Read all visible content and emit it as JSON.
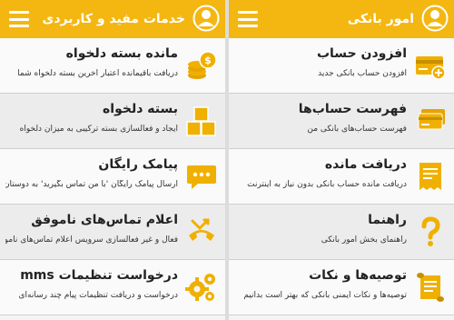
{
  "colors": {
    "accent": "#f4b611",
    "icon": "#f0b000",
    "text": "#222222"
  },
  "right_panel": {
    "title": "امور بانکی",
    "items": [
      {
        "title": "افزودن حساب",
        "subtitle": "افزودن حساب بانکی جدید",
        "icon": "add-card-icon"
      },
      {
        "title": "فهرست حساب‌ها",
        "subtitle": "فهرست حساب‌های بانکی من",
        "icon": "cards-list-icon"
      },
      {
        "title": "دریافت مانده",
        "subtitle": "دریافت مانده حساب بانکی بدون نیاز به اینترنت",
        "icon": "balance-receipt-icon"
      },
      {
        "title": "راهنما",
        "subtitle": "راهنمای بخش امور بانکی",
        "icon": "help-icon"
      },
      {
        "title": "توصیه‌ها و نکات",
        "subtitle": "توصیه‌ها و نکات ایمنی بانکی که بهتر است بدانیم",
        "icon": "tips-scroll-icon"
      }
    ]
  },
  "left_panel": {
    "title": "خدمات مفید و کاربردی",
    "items": [
      {
        "title": "مانده بسته دلخواه",
        "subtitle": "دریافت باقیمانده اعتبار آخرین بسته دلخواه شما",
        "icon": "coins-icon"
      },
      {
        "title": "بسته دلخواه",
        "subtitle": "ایجاد و فعالسازی بسته ترکیبی به میزان دلخواه",
        "icon": "boxes-icon"
      },
      {
        "title": "پیامک رایگان",
        "subtitle": "ارسال پیامک رایگان 'با من تماس بگیرید' به دوستان",
        "icon": "sms-bubble-icon"
      },
      {
        "title": "اعلام تماس‌های ناموفق",
        "subtitle": "فعال و غیر فعالسازی سرویس اعلام تماس‌های ناموفق",
        "icon": "missed-call-icon"
      },
      {
        "title": "درخواست تنظیمات mms",
        "subtitle": "درخواست و دریافت تنظیمات پیام چند رسانه‌ای",
        "icon": "settings-gears-icon"
      }
    ]
  }
}
